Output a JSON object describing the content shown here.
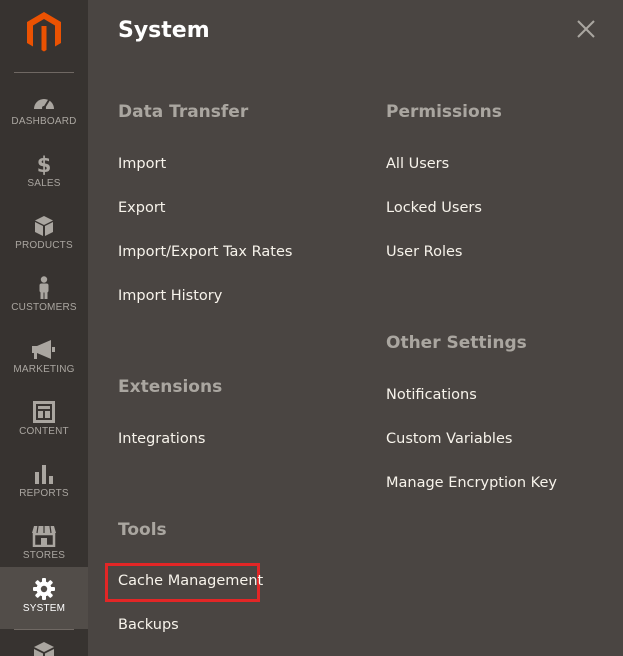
{
  "sidebar": {
    "logo_icon": "magento-logo-icon",
    "items": [
      {
        "label": "DASHBOARD",
        "icon": "dashboard-gauge-icon"
      },
      {
        "label": "SALES",
        "icon": "dollar-icon"
      },
      {
        "label": "PRODUCTS",
        "icon": "cube-icon"
      },
      {
        "label": "CUSTOMERS",
        "icon": "person-icon"
      },
      {
        "label": "MARKETING",
        "icon": "megaphone-icon"
      },
      {
        "label": "CONTENT",
        "icon": "layout-icon"
      },
      {
        "label": "REPORTS",
        "icon": "bar-chart-icon"
      },
      {
        "label": "STORES",
        "icon": "storefront-icon"
      },
      {
        "label": "SYSTEM",
        "icon": "gear-icon",
        "active": true
      }
    ]
  },
  "panel": {
    "title": "System",
    "close_icon": "close-icon",
    "sections": {
      "data_transfer": {
        "title": "Data Transfer",
        "links": [
          "Import",
          "Export",
          "Import/Export Tax Rates",
          "Import History"
        ]
      },
      "extensions": {
        "title": "Extensions",
        "links": [
          "Integrations"
        ]
      },
      "tools": {
        "title": "Tools",
        "links": [
          "Cache Management",
          "Backups"
        ]
      },
      "permissions": {
        "title": "Permissions",
        "links": [
          "All Users",
          "Locked Users",
          "User Roles"
        ]
      },
      "other_settings": {
        "title": "Other Settings",
        "links": [
          "Notifications",
          "Custom Variables",
          "Manage Encryption Key"
        ]
      }
    },
    "highlighted_link": "Cache Management"
  },
  "colors": {
    "sidebar_bg": "#373330",
    "panel_bg": "#4a4542",
    "active_bg": "#524d49",
    "accent_orange": "#eb5202",
    "highlight_red": "#e22626"
  }
}
